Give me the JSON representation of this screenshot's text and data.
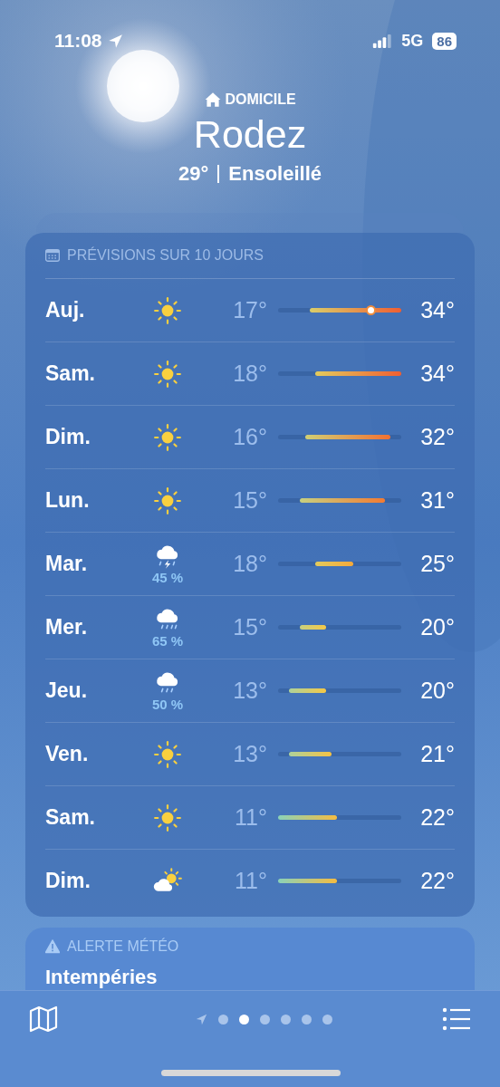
{
  "status_bar": {
    "time": "11:08",
    "network": "5G",
    "battery": "86"
  },
  "header": {
    "place_label": "DOMICILE",
    "city": "Rodez",
    "temperature": "29°",
    "condition": "Ensoleillé"
  },
  "forecast": {
    "title": "PRÉVISIONS SUR 10 JOURS",
    "days": [
      {
        "day": "Auj.",
        "kind": "sun",
        "low": "17°",
        "high": "34°",
        "current": {
          "level": 0.75
        }
      },
      {
        "day": "Sam.",
        "kind": "sun",
        "low": "18°",
        "high": "34°"
      },
      {
        "day": "Dim.",
        "kind": "sun",
        "low": "16°",
        "high": "32°"
      },
      {
        "day": "Lun.",
        "kind": "sun",
        "low": "15°",
        "high": "31°"
      },
      {
        "day": "Mar.",
        "kind": "thunder",
        "precip": "45 %",
        "low": "18°",
        "high": "25°"
      },
      {
        "day": "Mer.",
        "kind": "rain",
        "precip": "65 %",
        "low": "15°",
        "high": "20°"
      },
      {
        "day": "Jeu.",
        "kind": "drizzle",
        "precip": "50 %",
        "low": "13°",
        "high": "20°"
      },
      {
        "day": "Ven.",
        "kind": "sun",
        "low": "13°",
        "high": "21°"
      },
      {
        "day": "Sam.",
        "kind": "sun",
        "low": "11°",
        "high": "22°"
      },
      {
        "day": "Dim.",
        "kind": "partly",
        "low": "11°",
        "high": "22°"
      }
    ]
  },
  "alert": {
    "title": "ALERTE MÉTÉO",
    "headline": "Intempéries"
  },
  "pages": [
    {
      "kind": "location",
      "selected": false
    },
    {
      "kind": "dot",
      "selected": false
    },
    {
      "kind": "dot",
      "selected": true
    },
    {
      "kind": "dot",
      "selected": false
    },
    {
      "kind": "dot",
      "selected": false
    },
    {
      "kind": "dot",
      "selected": false
    },
    {
      "kind": "dot",
      "selected": false
    }
  ]
}
